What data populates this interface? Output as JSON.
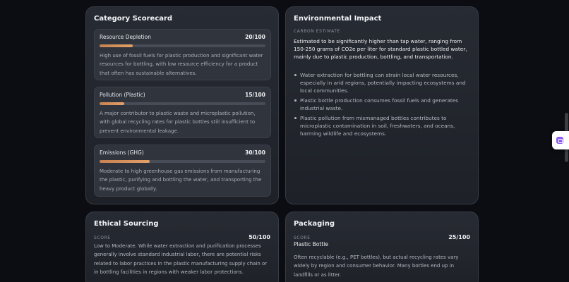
{
  "scorecard": {
    "title": "Category Scorecard",
    "metrics": [
      {
        "name": "Resource Depletion",
        "score": "20/100",
        "fill": 0.2,
        "description": "High use of fossil fuels for plastic production and significant water resources for bottling, with low resource efficiency for a product that often has sustainable alternatives."
      },
      {
        "name": "Pollution (Plastic)",
        "score": "15/100",
        "fill": 0.15,
        "description": "A major contributor to plastic waste and microplastic pollution, with global recycling rates for plastic bottles still insufficient to prevent environmental leakage."
      },
      {
        "name": "Emissions (GHG)",
        "score": "30/100",
        "fill": 0.3,
        "description": "Moderate to high greenhouse gas emissions from manufacturing the plastic, purifying and bottling the water, and transporting the heavy product globally."
      }
    ]
  },
  "environmental": {
    "title": "Environmental Impact",
    "eyebrow": "CARBON ESTIMATE",
    "lead": "Estimated to be significantly higher than tap water, ranging from 150-250 grams of CO2e per liter for standard plastic bottled water, mainly due to plastic production, bottling, and transportation.",
    "points": [
      "Water extraction for bottling can strain local water resources, especially in arid regions, potentially impacting ecosystems and local communities.",
      "Plastic bottle production consumes fossil fuels and generates industrial waste.",
      "Plastic pollution from mismanaged bottles contributes to microplastic contamination in soil, freshwaters, and oceans, harming wildlife and ecosystems."
    ]
  },
  "ethical": {
    "title": "Ethical Sourcing",
    "score_label": "SCORE",
    "score": "50/100",
    "text": "Low to Moderate. While water extraction and purification processes generally involve standard industrial labor, there are potential risks related to labor practices in the plastic manufacturing supply chain or in bottling facilities in regions with weaker labor protections."
  },
  "packaging": {
    "title": "Packaging",
    "score_label": "SCORE",
    "score": "25/100",
    "subtitle": "Plastic Bottle",
    "text": "Often recyclable (e.g., PET bottles), but actual recycling rates vary widely by region and consumer behavior. Many bottles end up in landfills or as litter."
  },
  "colors": {
    "background": "#0b0d12",
    "card": "#23272e",
    "bar_accent": "#e2a06a",
    "widget_accent": "#8b5cf6"
  }
}
